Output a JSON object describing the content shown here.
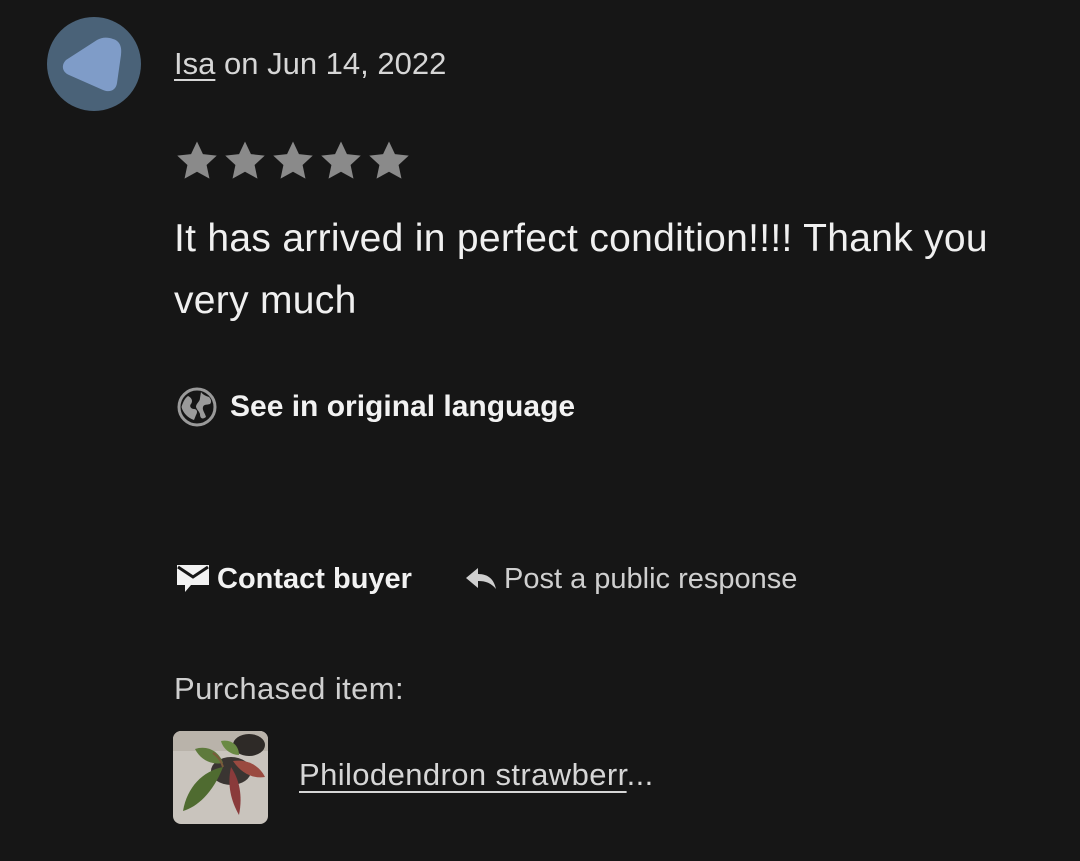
{
  "review": {
    "author": "Isa",
    "date_prefix": " on ",
    "date": "Jun 14, 2022",
    "rating": 5,
    "rating_max": 5,
    "star_color": "#8a8a8a",
    "text": "It has arrived in perfect condition!!!! Thank you very much"
  },
  "avatar": {
    "icon": "avatar-shape-icon",
    "background": "#4a6278",
    "shape_color": "#7f9cc8"
  },
  "translate": {
    "icon": "globe-icon",
    "label": "See in original language"
  },
  "actions": {
    "contact": {
      "icon": "message-icon",
      "label": "Contact buyer"
    },
    "reply": {
      "icon": "reply-arrow-icon",
      "label": "Post a public response"
    }
  },
  "purchase": {
    "label": "Purchased item:",
    "item_name": "Philodendron strawberr",
    "item_ellipsis": "..."
  }
}
